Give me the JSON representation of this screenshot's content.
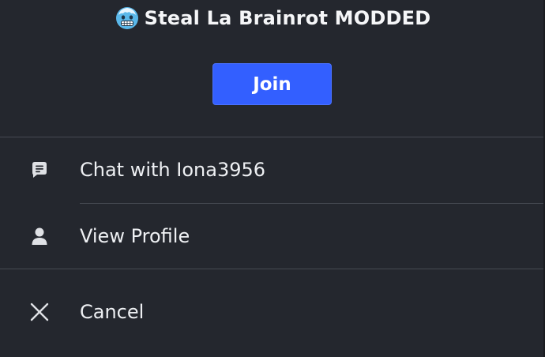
{
  "header": {
    "game_icon": "cold-face-emoji-icon",
    "title": "Steal La Brainrot MODDED"
  },
  "join_button": {
    "label": "Join"
  },
  "menu": {
    "items": [
      {
        "icon": "chat-bubble-icon",
        "label": "Chat with Iona3956"
      },
      {
        "icon": "person-icon",
        "label": "View Profile"
      },
      {
        "icon": "close-icon",
        "label": "Cancel"
      }
    ]
  },
  "colors": {
    "background": "#24272e",
    "join_button": "#335fff",
    "divider": "#464a52",
    "text": "#f2f3f5",
    "icon": "#dfe1e5"
  }
}
